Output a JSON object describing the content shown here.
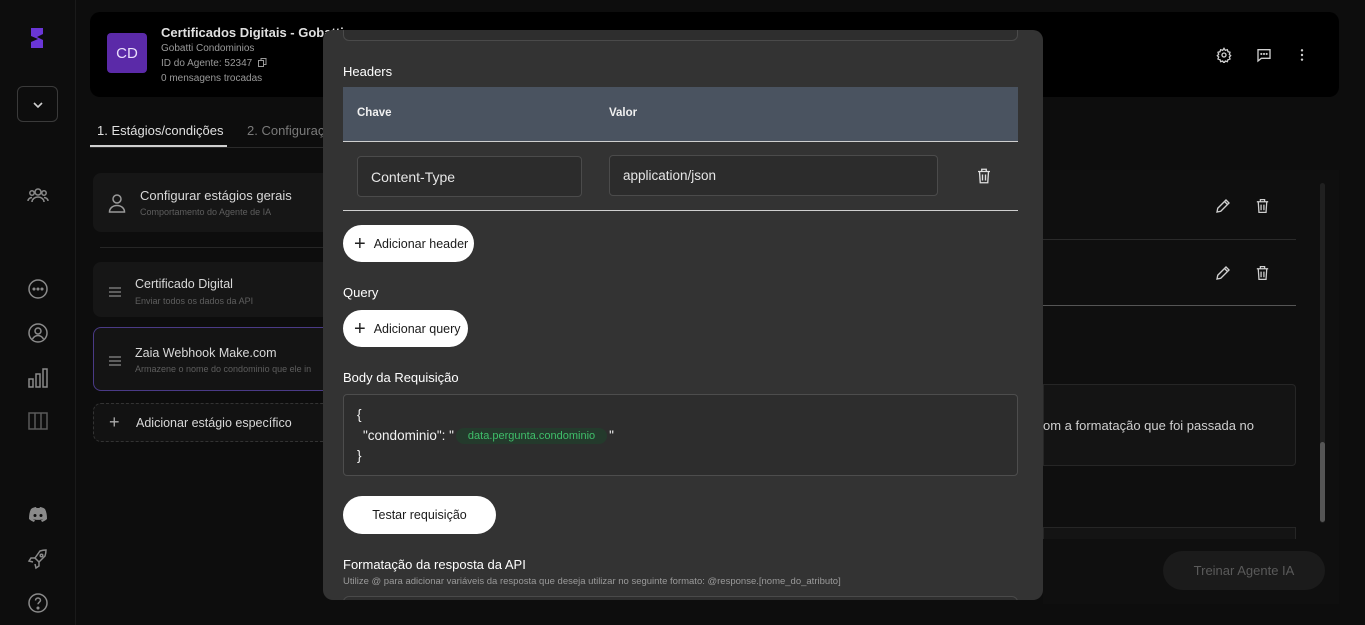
{
  "agent": {
    "initials": "CD",
    "title": "Certificados Digitais - Gobatti",
    "company": "Gobatti Condominios",
    "agent_id": "ID do Agente: 52347",
    "messages": "0 mensagens trocadas"
  },
  "tabs": [
    {
      "label": "1. Estágios/condições"
    },
    {
      "label": "2. Configuraç"
    }
  ],
  "stages": [
    {
      "title": "Configurar estágios gerais",
      "subtitle": "Comportamento do Agente de IA"
    },
    {
      "title": "Certificado Digital",
      "subtitle": "Enviar todos os dados da API"
    },
    {
      "title": "Zaia Webhook Make.com",
      "subtitle": "Armazene o nome do condominio que ele in"
    }
  ],
  "add_stage_label": "Adicionar estágio específico",
  "right_panel": {
    "text_fragment": "om a formatação que foi passada no",
    "train_button": "Treinar Agente IA"
  },
  "modal": {
    "headers_label": "Headers",
    "table": {
      "col_key": "Chave",
      "col_value": "Valor",
      "rows": [
        {
          "key": "Content-Type",
          "value": "application/json"
        }
      ]
    },
    "add_header": "Adicionar header",
    "query_label": "Query",
    "add_query": "Adicionar query",
    "body_label": "Body da Requisição",
    "body": {
      "open": "{",
      "key_prefix": "\"condominio\": \"",
      "variable": "data.pergunta.condominio",
      "suffix": "\"",
      "close": "}"
    },
    "test_button": "Testar requisição",
    "format_label": "Formatação da resposta da API",
    "format_hint": "Utilize @ para adicionar variáveis da resposta que deseja utilizar no seguinte formato: @response.[nome_do_atributo]"
  }
}
